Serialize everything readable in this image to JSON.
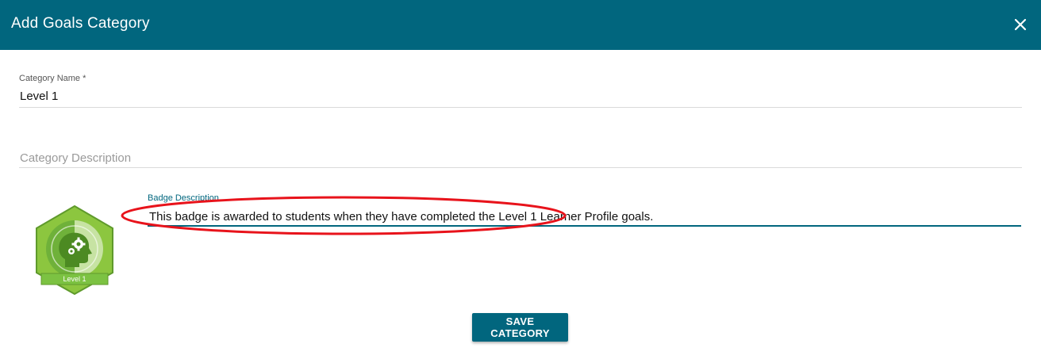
{
  "dialog": {
    "title": "Add Goals Category",
    "close_icon": "close-icon"
  },
  "form": {
    "category_name": {
      "label": "Category Name *",
      "value": "Level 1"
    },
    "category_description": {
      "placeholder": "Category Description",
      "value": ""
    },
    "badge": {
      "label": "Level 1",
      "icon": "head-gears-badge-icon",
      "color": "#7cc242"
    },
    "badge_description": {
      "label": "Badge Description",
      "value": "This badge is awarded to students when they have completed the Level 1 Learner Profile goals."
    },
    "save_label": "SAVE CATEGORY"
  },
  "colors": {
    "primary": "#01667e",
    "annotation": "#e8131b",
    "badge_green": "#7cc242"
  }
}
